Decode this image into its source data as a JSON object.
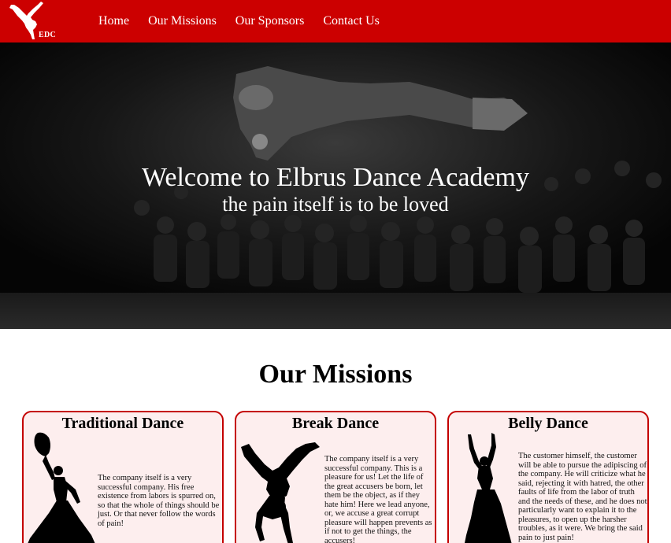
{
  "brand": {
    "logo_text": "EDC",
    "logo_icon": "breakdancer-icon"
  },
  "nav": {
    "items": [
      {
        "label": "Home"
      },
      {
        "label": "Our Missions"
      },
      {
        "label": "Our Sponsors"
      },
      {
        "label": "Contact Us"
      }
    ]
  },
  "hero": {
    "title": "Welcome to Elbrus Dance Academy",
    "subtitle": "the pain itself is to be loved"
  },
  "missions": {
    "title": "Our Missions",
    "cards": [
      {
        "title": "Traditional Dance",
        "icon": "flamenco-dancer-icon",
        "text": "The company itself is a very successful company. His free existence from labors is spurred on, so that the whole of things should be just. Or that never follow the words of pain!"
      },
      {
        "title": "Break Dance",
        "icon": "breakdancer-icon",
        "text": "The company itself is a very successful company. This is a pleasure for us! Let the life of the great accusers be born, let them be the object, as if they hate him! Here we lead anyone, or, we accuse a great corrupt pleasure will happen prevents as if not to get the things, the accusers!"
      },
      {
        "title": "Belly Dance",
        "icon": "belly-dancer-icon",
        "text": "The customer himself, the customer will be able to pursue the adipiscing of the company. He will criticize what he said, rejecting it with hatred, the other faults of life from the labor of truth and the needs of these, and he does not particularly want to explain it to the pleasures, to open up the harsher troubles, as it were. We bring the said pain to just pain!"
      }
    ]
  },
  "colors": {
    "brand_red": "#cc0000",
    "card_border": "#c40000",
    "card_bg": "#fdeeee"
  }
}
